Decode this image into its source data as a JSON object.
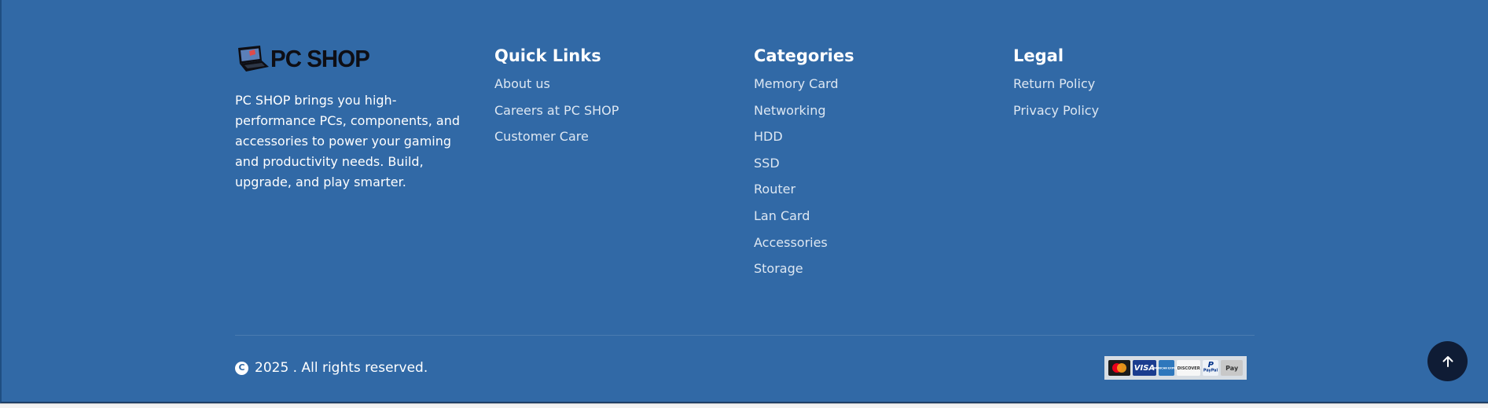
{
  "brand": {
    "name": "PC SHOP",
    "description": "PC SHOP brings you high-performance PCs, components, and accessories to power your gaming and productivity needs. Build, upgrade, and play smarter."
  },
  "quick_links": {
    "title": "Quick Links",
    "items": [
      "About us",
      "Careers at PC SHOP",
      "Customer Care"
    ]
  },
  "categories": {
    "title": "Categories",
    "items": [
      "Memory Card",
      "Networking",
      "HDD",
      "SSD",
      "Router",
      "Lan Card",
      "Accessories",
      "Storage"
    ]
  },
  "legal": {
    "title": "Legal",
    "items": [
      "Return Policy",
      "Privacy Policy"
    ]
  },
  "copyright": {
    "symbol": "C",
    "text": "2025 . All rights reserved."
  },
  "payments": {
    "icons": [
      "mastercard-icon",
      "visa-icon",
      "amex-icon",
      "discover-icon",
      "paypal-icon",
      "apple-pay-icon"
    ],
    "labels": {
      "visa": "VISA",
      "amex": "AMERICAN EXPRESS",
      "discover": "DISCOVER",
      "paypal": "PayPal",
      "apple": "Pay"
    }
  },
  "back_to_top": {
    "icon": "arrow-up-icon"
  },
  "colors": {
    "footer_bg": "#3169a6",
    "link_text": "#dde7f2",
    "heading_text": "#ffffff",
    "back_to_top_bg": "#0f1c35"
  }
}
